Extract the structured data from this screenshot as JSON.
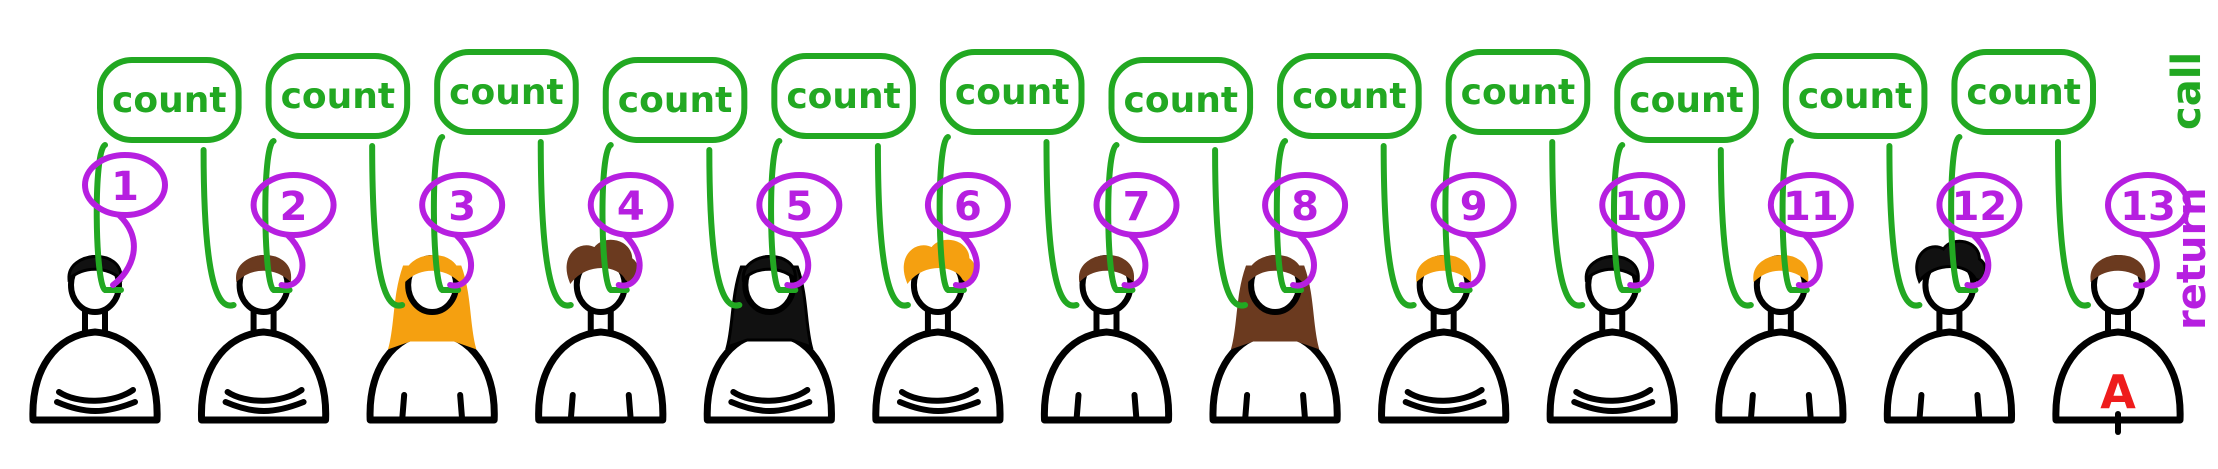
{
  "colors": {
    "call": "#22a822",
    "return": "#b61fe0",
    "outline": "#000000",
    "hair_black": "#111111",
    "hair_brown": "#6b3a1f",
    "hair_orange": "#f5a010",
    "letter": "#ee1c1c"
  },
  "labels": {
    "call": "call",
    "return": "return",
    "bubble_word": "count",
    "shirt_letter": "A"
  },
  "people": [
    {
      "number": "1",
      "hair": "black",
      "hair_style": "short",
      "pose": "arms"
    },
    {
      "number": "2",
      "hair": "brown",
      "hair_style": "short",
      "pose": "arms"
    },
    {
      "number": "3",
      "hair": "orange",
      "hair_style": "bob",
      "pose": "plain"
    },
    {
      "number": "4",
      "hair": "brown",
      "hair_style": "curly",
      "pose": "plain"
    },
    {
      "number": "5",
      "hair": "black",
      "hair_style": "long",
      "pose": "arms"
    },
    {
      "number": "6",
      "hair": "orange",
      "hair_style": "fluffy",
      "pose": "arms"
    },
    {
      "number": "7",
      "hair": "brown",
      "hair_style": "medium",
      "pose": "plain"
    },
    {
      "number": "8",
      "hair": "brown",
      "hair_style": "long",
      "pose": "plain"
    },
    {
      "number": "9",
      "hair": "orange",
      "hair_style": "short",
      "pose": "arms"
    },
    {
      "number": "10",
      "hair": "black",
      "hair_style": "short",
      "pose": "arms"
    },
    {
      "number": "11",
      "hair": "orange",
      "hair_style": "short",
      "pose": "plain"
    },
    {
      "number": "12",
      "hair": "black",
      "hair_style": "curly",
      "pose": "plain"
    },
    {
      "number": "13",
      "hair": "brown",
      "hair_style": "short",
      "pose": "letter"
    }
  ],
  "count_bubbles": 12
}
